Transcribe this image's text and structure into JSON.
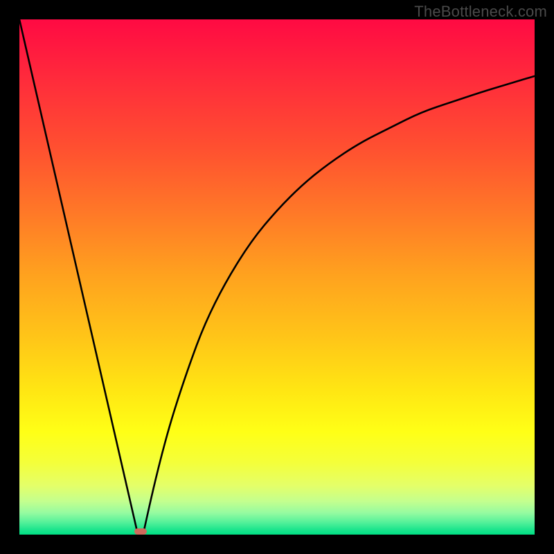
{
  "watermark": "TheBottleneck.com",
  "gradient": {
    "stops": [
      {
        "offset": 0.0,
        "color": "#ff0a43"
      },
      {
        "offset": 0.12,
        "color": "#ff2c3b"
      },
      {
        "offset": 0.25,
        "color": "#ff5030"
      },
      {
        "offset": 0.38,
        "color": "#ff7a27"
      },
      {
        "offset": 0.5,
        "color": "#ffa31e"
      },
      {
        "offset": 0.62,
        "color": "#ffc618"
      },
      {
        "offset": 0.72,
        "color": "#ffe613"
      },
      {
        "offset": 0.8,
        "color": "#ffff16"
      },
      {
        "offset": 0.86,
        "color": "#f4ff3a"
      },
      {
        "offset": 0.905,
        "color": "#e4ff69"
      },
      {
        "offset": 0.935,
        "color": "#c4ff8e"
      },
      {
        "offset": 0.958,
        "color": "#95fba0"
      },
      {
        "offset": 0.976,
        "color": "#55f19a"
      },
      {
        "offset": 0.99,
        "color": "#1de58d"
      },
      {
        "offset": 1.0,
        "color": "#00df84"
      }
    ]
  },
  "chart_data": {
    "type": "line",
    "title": "",
    "xlabel": "",
    "ylabel": "",
    "xlim": [
      0,
      100
    ],
    "ylim": [
      0,
      100
    ],
    "series": [
      {
        "name": "left-line",
        "x": [
          0,
          23
        ],
        "y": [
          100,
          0
        ]
      },
      {
        "name": "right-curve",
        "x": [
          24,
          26,
          28,
          30,
          33,
          36,
          40,
          45,
          50,
          55,
          60,
          66,
          72,
          78,
          84,
          90,
          95,
          100
        ],
        "y": [
          0,
          9,
          17,
          24,
          33,
          41,
          49,
          57,
          63,
          68,
          72,
          76,
          79,
          82,
          84,
          86,
          87.5,
          89
        ]
      }
    ],
    "annotations": [
      {
        "name": "minimum-marker",
        "x": 23.5,
        "y": 0,
        "width_pct": 2.4,
        "height_pct": 1.2
      }
    ]
  }
}
